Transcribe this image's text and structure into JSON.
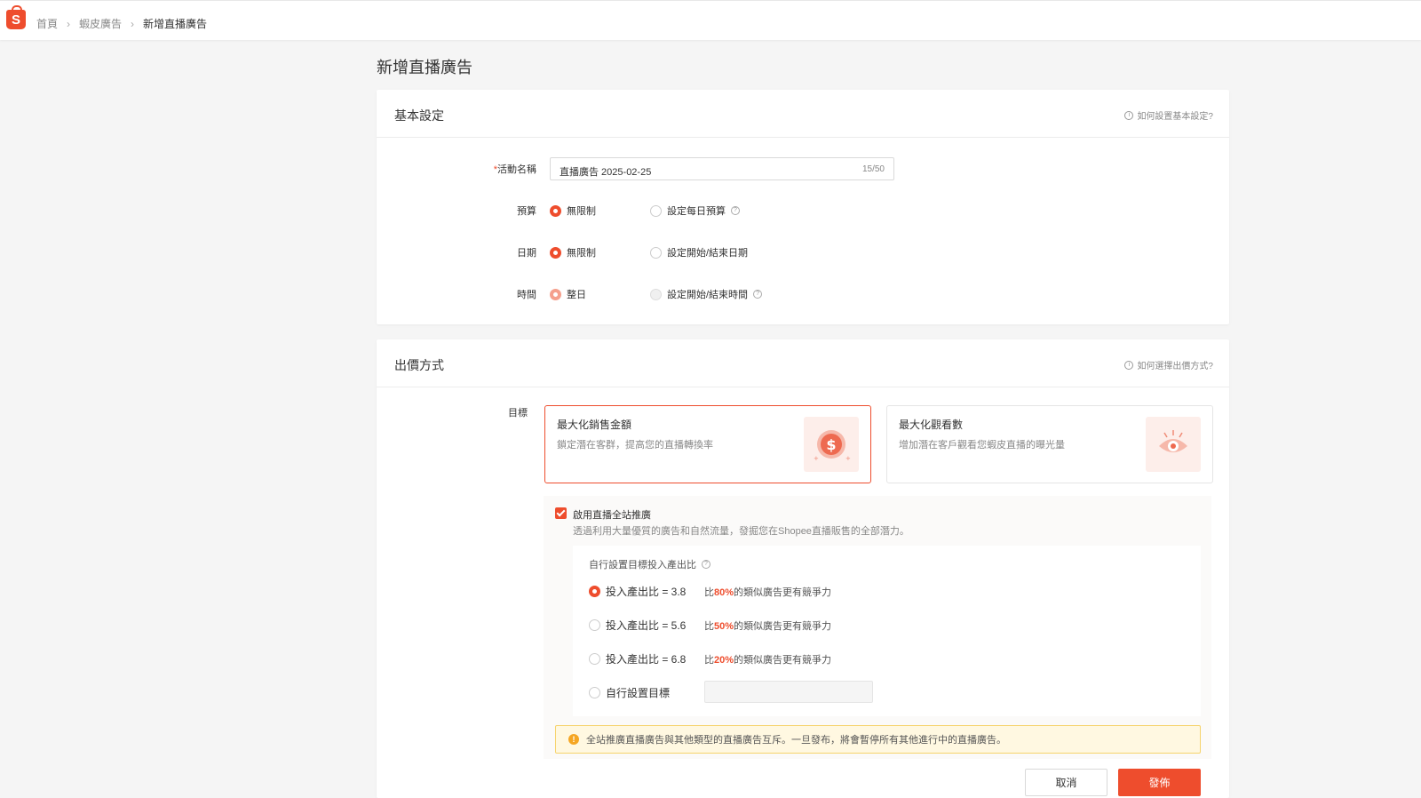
{
  "breadcrumb": [
    "首頁",
    "蝦皮廣告",
    "新增直播廣告"
  ],
  "page_title": "新增直播廣告",
  "basic": {
    "title": "基本設定",
    "help": "如何設置基本設定?",
    "name_label": "活動名稱",
    "name_value": "直播廣告 2025-02-25",
    "name_count": "15/50",
    "budget_label": "預算",
    "budget_opt1": "無限制",
    "budget_opt2": "設定每日預算",
    "date_label": "日期",
    "date_opt1": "無限制",
    "date_opt2": "設定開始/結束日期",
    "time_label": "時間",
    "time_opt1": "整日",
    "time_opt2": "設定開始/結束時間"
  },
  "bidding": {
    "title": "出價方式",
    "help": "如何選擇出價方式?",
    "goal_label": "目標",
    "goal1_title": "最大化銷售金額",
    "goal1_desc": "鎖定潛在客群，提高您的直播轉換率",
    "goal2_title": "最大化觀看數",
    "goal2_desc": "增加潛在客戶觀看您蝦皮直播的曝光量",
    "boost_title": "啟用直播全站推廣",
    "boost_desc": "透過利用大量優質的廣告和自然流量，發掘您在Shopee直播販售的全部潛力。",
    "roas_title": "自行設置目標投入產出比",
    "options": [
      {
        "label": "投入產出比 = 3.8",
        "pre": "比",
        "pct": "80%",
        "post": "的類似廣告更有競爭力"
      },
      {
        "label": "投入產出比 = 5.6",
        "pre": "比",
        "pct": "50%",
        "post": "的類似廣告更有競爭力"
      },
      {
        "label": "投入產出比 = 6.8",
        "pre": "比",
        "pct": "20%",
        "post": "的類似廣告更有競爭力"
      }
    ],
    "custom_label": "自行設置目標",
    "warning": "全站推廣直播廣告與其他類型的直播廣告互斥。一旦發布，將會暫停所有其他進行中的直播廣告。"
  },
  "buttons": {
    "cancel": "取消",
    "publish": "發佈"
  }
}
